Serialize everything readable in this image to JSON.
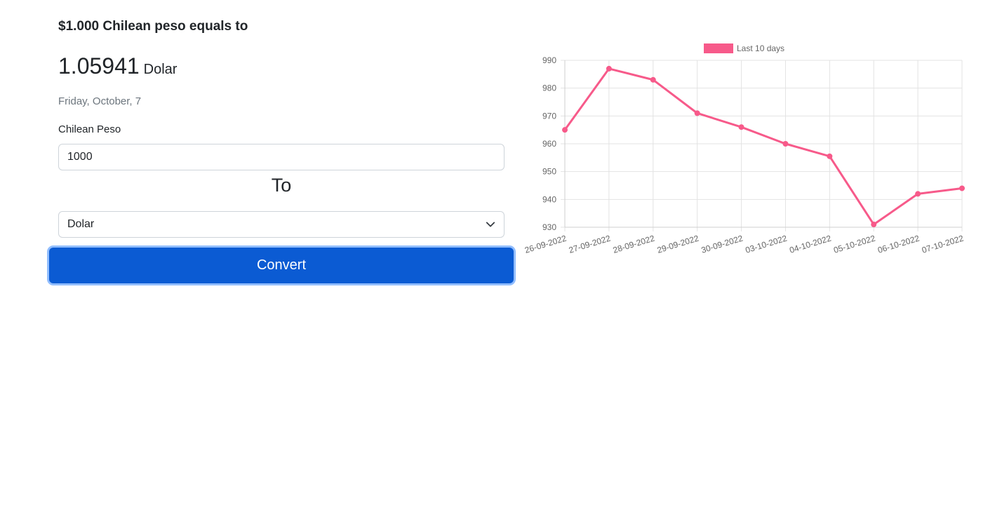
{
  "converter": {
    "heading": "$1.000 Chilean peso equals to",
    "rate_value": "1.05941",
    "rate_unit": "Dolar",
    "date": "Friday, October, 7",
    "from_label": "Chilean Peso",
    "amount_value": "1000",
    "to_label": "To",
    "to_currency": "Dolar",
    "convert_label": "Convert"
  },
  "colors": {
    "accent": "#0b5bd3",
    "series": "#f75a8a"
  },
  "icons": {
    "select_arrow": "chevron-down-icon"
  },
  "chart_data": {
    "type": "line",
    "categories": [
      "26-09-2022",
      "27-09-2022",
      "28-09-2022",
      "29-09-2022",
      "30-09-2022",
      "03-10-2022",
      "04-10-2022",
      "05-10-2022",
      "06-10-2022",
      "07-10-2022"
    ],
    "series": [
      {
        "name": "Last 10 days",
        "values": [
          965,
          987,
          983,
          971,
          966,
          960,
          955.5,
          931,
          942,
          944
        ]
      }
    ],
    "yticks": [
      930,
      940,
      950,
      960,
      970,
      980,
      990
    ],
    "ylim": [
      930,
      990
    ],
    "grid": true,
    "legend": "top-center",
    "title": "",
    "xlabel": "",
    "ylabel": ""
  }
}
